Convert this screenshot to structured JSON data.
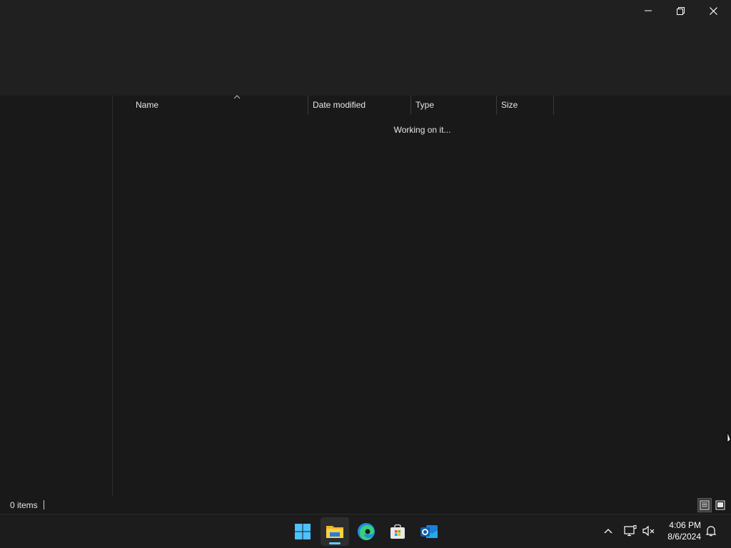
{
  "window": {
    "caption": {
      "minimize_icon": "minimize-icon",
      "restore_icon": "restore-icon",
      "close_icon": "close-icon"
    }
  },
  "columns": {
    "name": "Name",
    "date_modified": "Date modified",
    "type": "Type",
    "size": "Size",
    "sort_icon": "chevron-up-icon"
  },
  "content": {
    "status_message": "Working on it..."
  },
  "statusbar": {
    "item_count": "0 items",
    "views": [
      "details-view-icon",
      "large-icons-view-icon"
    ],
    "active_view": "details-view-icon"
  },
  "taskbar": {
    "apps": [
      "start-icon",
      "file-explorer-icon",
      "edge-icon",
      "microsoft-store-icon",
      "outlook-icon"
    ],
    "active_app": "file-explorer-icon",
    "tray": [
      "chevron-up-icon",
      "network-icon",
      "volume-muted-icon",
      "notification-icon"
    ],
    "clock": {
      "time": "4:06 PM",
      "date": "8/6/2024"
    }
  },
  "colors": {
    "accent": "#60cdff",
    "window_bg": "#191919",
    "titlebar_bg": "#202020",
    "taskbar_bg": "#1c1c1c"
  }
}
